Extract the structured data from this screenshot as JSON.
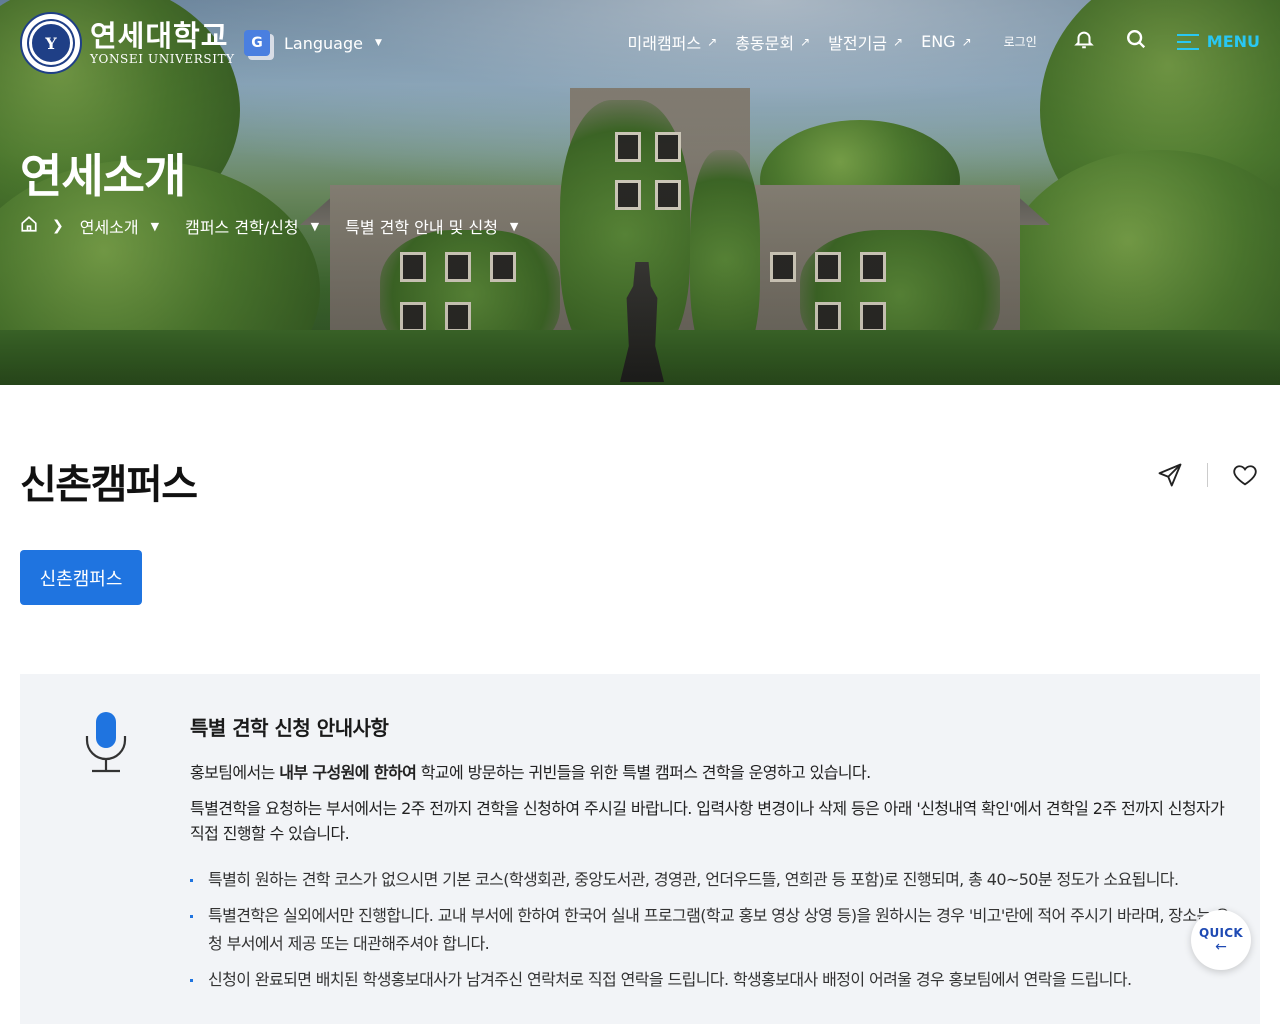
{
  "header": {
    "logo_kr": "연세대학교",
    "logo_en": "YONSEI UNIVERSITY",
    "seal_glyph": "Y",
    "language_label": "Language",
    "language_icon": "google-translate-icon",
    "nav": [
      {
        "label": "미래캠퍼스",
        "arrow": "↗"
      },
      {
        "label": "총동문회",
        "arrow": "↗"
      },
      {
        "label": "발전기금",
        "arrow": "↗"
      },
      {
        "label": "ENG",
        "arrow": "↗"
      }
    ],
    "login_label": "로그인",
    "menu_label": "MENU",
    "accent_color": "#29c7f2"
  },
  "hero": {
    "title": "연세소개",
    "breadcrumb": [
      "연세소개",
      "캠퍼스 견학/신청",
      "특별 견학 안내 및 신청"
    ]
  },
  "main": {
    "page_title": "신촌캠퍼스",
    "tab_label": "신촌캠퍼스",
    "tab_color": "#1f74e0"
  },
  "notice": {
    "title": "특별 견학 신청 안내사항",
    "p1_pre": "홍보팀에서는 ",
    "p1_bold": "내부 구성원에 한하여",
    "p1_post": " 학교에 방문하는 귀빈들을 위한 특별 캠퍼스 견학을 운영하고 있습니다.",
    "p2": "특별견학을 요청하는 부서에서는 2주 전까지 견학을 신청하여 주시길 바랍니다. 입력사항 변경이나 삭제 등은 아래 '신청내역 확인'에서 견학일 2주 전까지 신청자가 직접 진행할 수 있습니다.",
    "bullets": [
      "특별히 원하는 견학 코스가 없으시면 기본 코스(학생회관, 중앙도서관, 경영관, 언더우드뜰, 연희관 등 포함)로 진행되며, 총 40~50분 정도가 소요됩니다.",
      "특별견학은 실외에서만 진행합니다. 교내 부서에 한하여 한국어 실내 프로그램(학교 홍보 영상 상영 등)을 원하시는 경우 '비고'란에 적어 주시기 바라며, 장소는 요청 부서에서 제공 또는 대관해주셔야 합니다.",
      "신청이 완료되면 배치된 학생홍보대사가 남겨주신 연락처로 직접 연락을 드립니다. 학생홍보대사 배정이 어려울 경우 홍보팀에서 연락을 드립니다."
    ]
  },
  "quick": {
    "label": "QUICK",
    "arrow": "←"
  }
}
